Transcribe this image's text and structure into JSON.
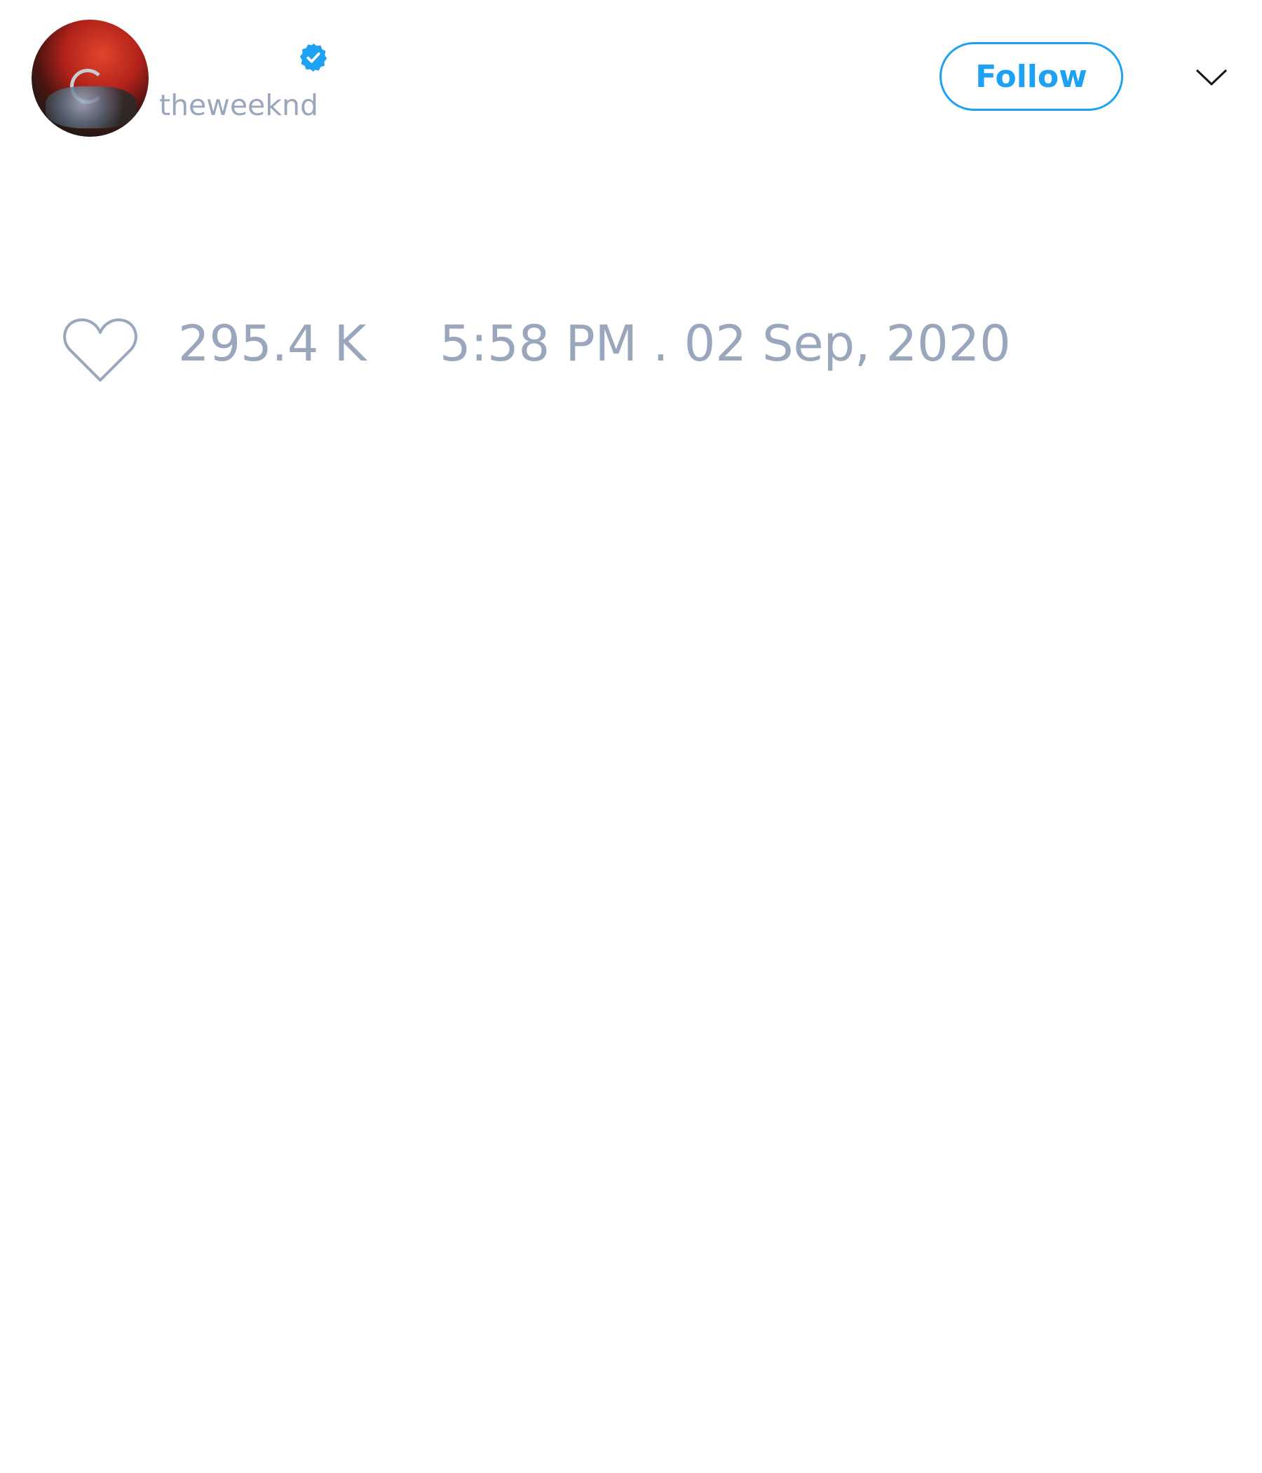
{
  "header": {
    "handle": "theweeknd",
    "verified": true,
    "follow_label": "Follow",
    "accent_color": "#1da1f2"
  },
  "stats": {
    "likes": "295.4 K",
    "timestamp": "5:58 PM . 02 Sep, 2020"
  },
  "icons": [
    "verified-badge-icon",
    "chevron-down-icon",
    "heart-icon"
  ]
}
